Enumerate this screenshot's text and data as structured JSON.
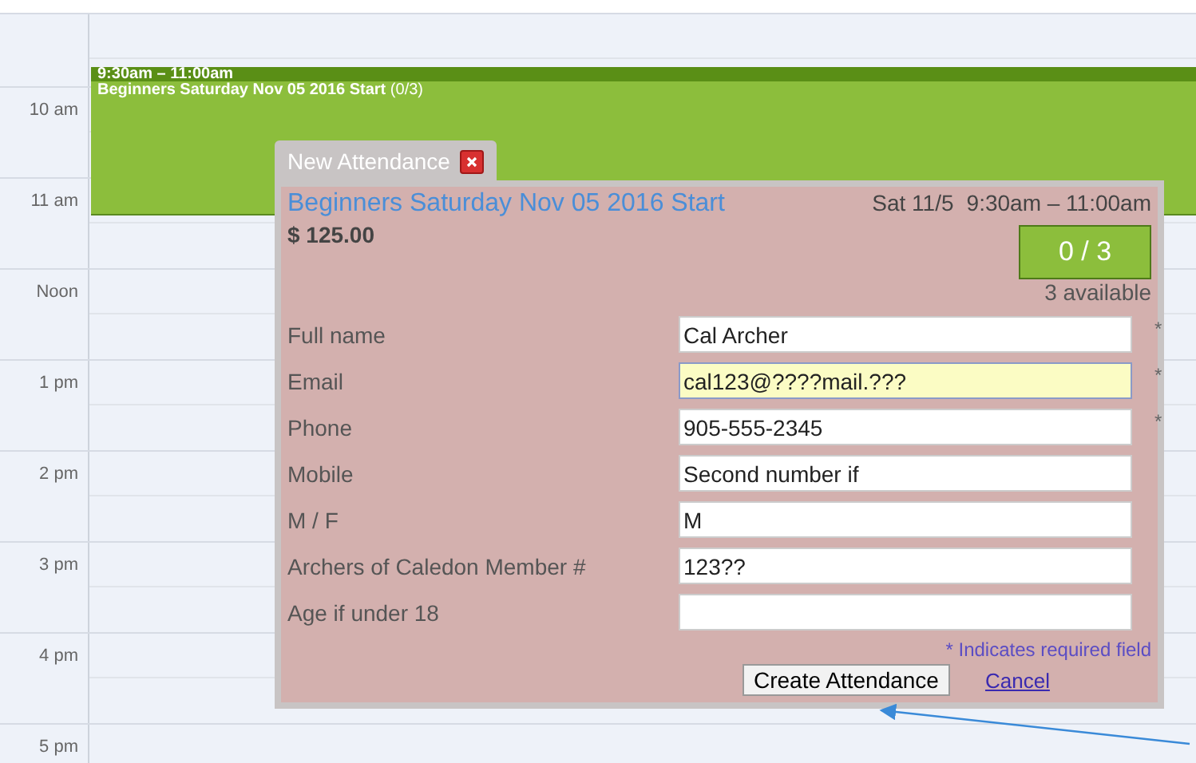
{
  "calendar": {
    "hours": [
      "10 am",
      "11 am",
      "Noon",
      "1 pm",
      "2 pm",
      "3 pm",
      "4 pm",
      "5 pm"
    ],
    "event": {
      "time": "9:30am – 11:00am",
      "title": "Beginners Saturday Nov 05 2016 Start",
      "count": "(0/3)"
    }
  },
  "dialog": {
    "tab_title": "New Attendance",
    "event_title": "Beginners Saturday Nov 05 2016 Start",
    "day": "Sat 11/5",
    "time": "9:30am – 11:00am",
    "price": "$ 125.00",
    "capacity": "0 / 3",
    "available": "3 available",
    "fields": [
      {
        "label": "Full name",
        "value": "Cal Archer",
        "required_mark": "*",
        "focused": false
      },
      {
        "label": "Email",
        "value": "cal123@????mail.???",
        "required_mark": "*",
        "focused": true
      },
      {
        "label": "Phone",
        "value": "905-555-2345",
        "required_mark": "*",
        "focused": false
      },
      {
        "label": "Mobile",
        "value": "Second number if",
        "focused": false
      },
      {
        "label": "M / F",
        "value": "M",
        "focused": false
      },
      {
        "label": "Archers of Caledon Member #",
        "value": "123??",
        "focused": false
      },
      {
        "label": "Age if under 18",
        "focused": false
      }
    ],
    "required_note": "* Indicates required field",
    "submit": "Create Attendance",
    "cancel": "Cancel"
  }
}
